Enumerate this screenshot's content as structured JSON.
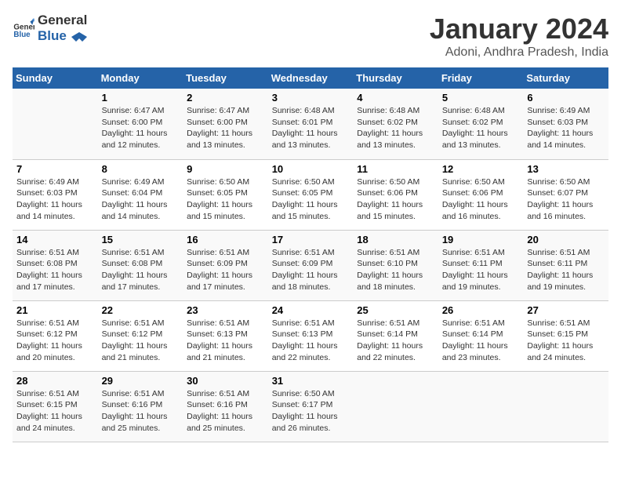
{
  "header": {
    "logo_line1": "General",
    "logo_line2": "Blue",
    "month": "January 2024",
    "location": "Adoni, Andhra Pradesh, India"
  },
  "days_of_week": [
    "Sunday",
    "Monday",
    "Tuesday",
    "Wednesday",
    "Thursday",
    "Friday",
    "Saturday"
  ],
  "weeks": [
    [
      {
        "day": "",
        "info": ""
      },
      {
        "day": "1",
        "info": "Sunrise: 6:47 AM\nSunset: 6:00 PM\nDaylight: 11 hours\nand 12 minutes."
      },
      {
        "day": "2",
        "info": "Sunrise: 6:47 AM\nSunset: 6:00 PM\nDaylight: 11 hours\nand 13 minutes."
      },
      {
        "day": "3",
        "info": "Sunrise: 6:48 AM\nSunset: 6:01 PM\nDaylight: 11 hours\nand 13 minutes."
      },
      {
        "day": "4",
        "info": "Sunrise: 6:48 AM\nSunset: 6:02 PM\nDaylight: 11 hours\nand 13 minutes."
      },
      {
        "day": "5",
        "info": "Sunrise: 6:48 AM\nSunset: 6:02 PM\nDaylight: 11 hours\nand 13 minutes."
      },
      {
        "day": "6",
        "info": "Sunrise: 6:49 AM\nSunset: 6:03 PM\nDaylight: 11 hours\nand 14 minutes."
      }
    ],
    [
      {
        "day": "7",
        "info": "Sunrise: 6:49 AM\nSunset: 6:03 PM\nDaylight: 11 hours\nand 14 minutes."
      },
      {
        "day": "8",
        "info": "Sunrise: 6:49 AM\nSunset: 6:04 PM\nDaylight: 11 hours\nand 14 minutes."
      },
      {
        "day": "9",
        "info": "Sunrise: 6:50 AM\nSunset: 6:05 PM\nDaylight: 11 hours\nand 15 minutes."
      },
      {
        "day": "10",
        "info": "Sunrise: 6:50 AM\nSunset: 6:05 PM\nDaylight: 11 hours\nand 15 minutes."
      },
      {
        "day": "11",
        "info": "Sunrise: 6:50 AM\nSunset: 6:06 PM\nDaylight: 11 hours\nand 15 minutes."
      },
      {
        "day": "12",
        "info": "Sunrise: 6:50 AM\nSunset: 6:06 PM\nDaylight: 11 hours\nand 16 minutes."
      },
      {
        "day": "13",
        "info": "Sunrise: 6:50 AM\nSunset: 6:07 PM\nDaylight: 11 hours\nand 16 minutes."
      }
    ],
    [
      {
        "day": "14",
        "info": "Sunrise: 6:51 AM\nSunset: 6:08 PM\nDaylight: 11 hours\nand 17 minutes."
      },
      {
        "day": "15",
        "info": "Sunrise: 6:51 AM\nSunset: 6:08 PM\nDaylight: 11 hours\nand 17 minutes."
      },
      {
        "day": "16",
        "info": "Sunrise: 6:51 AM\nSunset: 6:09 PM\nDaylight: 11 hours\nand 17 minutes."
      },
      {
        "day": "17",
        "info": "Sunrise: 6:51 AM\nSunset: 6:09 PM\nDaylight: 11 hours\nand 18 minutes."
      },
      {
        "day": "18",
        "info": "Sunrise: 6:51 AM\nSunset: 6:10 PM\nDaylight: 11 hours\nand 18 minutes."
      },
      {
        "day": "19",
        "info": "Sunrise: 6:51 AM\nSunset: 6:11 PM\nDaylight: 11 hours\nand 19 minutes."
      },
      {
        "day": "20",
        "info": "Sunrise: 6:51 AM\nSunset: 6:11 PM\nDaylight: 11 hours\nand 19 minutes."
      }
    ],
    [
      {
        "day": "21",
        "info": "Sunrise: 6:51 AM\nSunset: 6:12 PM\nDaylight: 11 hours\nand 20 minutes."
      },
      {
        "day": "22",
        "info": "Sunrise: 6:51 AM\nSunset: 6:12 PM\nDaylight: 11 hours\nand 21 minutes."
      },
      {
        "day": "23",
        "info": "Sunrise: 6:51 AM\nSunset: 6:13 PM\nDaylight: 11 hours\nand 21 minutes."
      },
      {
        "day": "24",
        "info": "Sunrise: 6:51 AM\nSunset: 6:13 PM\nDaylight: 11 hours\nand 22 minutes."
      },
      {
        "day": "25",
        "info": "Sunrise: 6:51 AM\nSunset: 6:14 PM\nDaylight: 11 hours\nand 22 minutes."
      },
      {
        "day": "26",
        "info": "Sunrise: 6:51 AM\nSunset: 6:14 PM\nDaylight: 11 hours\nand 23 minutes."
      },
      {
        "day": "27",
        "info": "Sunrise: 6:51 AM\nSunset: 6:15 PM\nDaylight: 11 hours\nand 24 minutes."
      }
    ],
    [
      {
        "day": "28",
        "info": "Sunrise: 6:51 AM\nSunset: 6:15 PM\nDaylight: 11 hours\nand 24 minutes."
      },
      {
        "day": "29",
        "info": "Sunrise: 6:51 AM\nSunset: 6:16 PM\nDaylight: 11 hours\nand 25 minutes."
      },
      {
        "day": "30",
        "info": "Sunrise: 6:51 AM\nSunset: 6:16 PM\nDaylight: 11 hours\nand 25 minutes."
      },
      {
        "day": "31",
        "info": "Sunrise: 6:50 AM\nSunset: 6:17 PM\nDaylight: 11 hours\nand 26 minutes."
      },
      {
        "day": "",
        "info": ""
      },
      {
        "day": "",
        "info": ""
      },
      {
        "day": "",
        "info": ""
      }
    ]
  ]
}
